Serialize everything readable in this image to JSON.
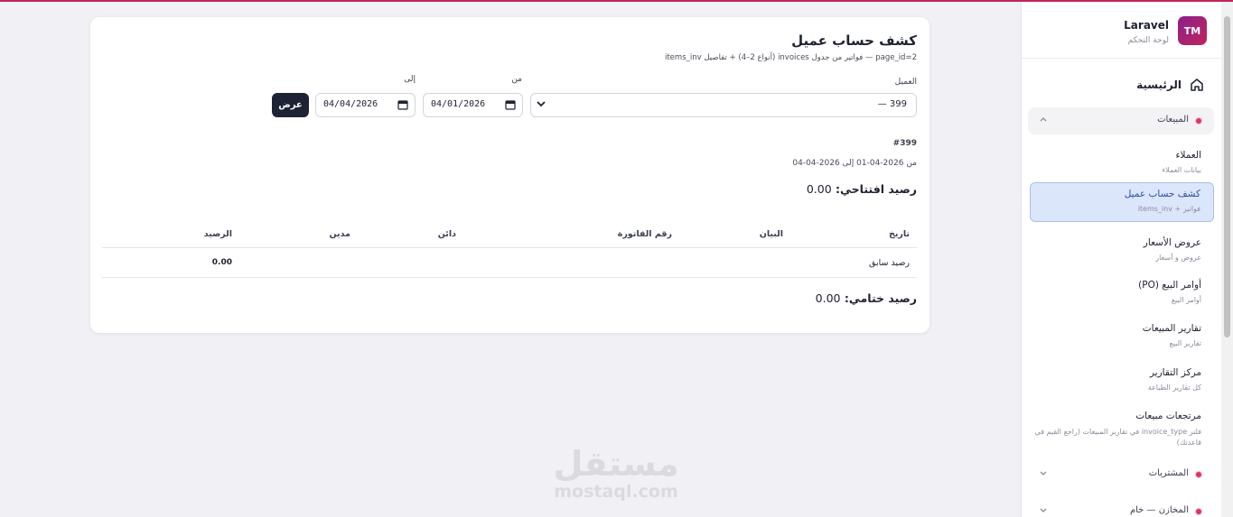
{
  "brand": {
    "logo": "TM",
    "name": "Laravel",
    "subtitle": "لوحة التحكم"
  },
  "sidebar": {
    "home_label": "الرئيسية",
    "groups": [
      {
        "label": "المبيعات",
        "icon": "chevron-up-icon"
      },
      {
        "label": "المشتريات",
        "icon": "chevron-down-icon"
      },
      {
        "label": "المخازن — خام",
        "icon": "chevron-down-icon"
      }
    ],
    "items": [
      {
        "label": "العملاء",
        "sub": "بيانات العملاء"
      },
      {
        "label": "كشف حساب عميل",
        "sub": "فواتير + items_inv",
        "active": true
      },
      {
        "label": "عروض الأسعار",
        "sub": "عروض و أسعار"
      },
      {
        "label": "أوامر البيع (PO)",
        "sub": "أوامر البيع"
      },
      {
        "label": "تقارير المبيعات",
        "sub": "تقارير البيع"
      },
      {
        "label": "مركز التقارير",
        "sub": "كل تقارير الطباعة"
      },
      {
        "label": "مرتجعات مبيعات",
        "sub": "فلتر invoice_type في تقارير المبيعات (راجع القيم في قاعدتك)"
      }
    ]
  },
  "page": {
    "title": "كشف حساب عميل",
    "subtitle": "page_id=2 — فواتير من جدول invoices (أنواع 2–4) + تفاصيل items_inv"
  },
  "filters": {
    "customer_label": "العميل",
    "customer_value": "399 —",
    "from_label": "من",
    "from_value": "04/01/2026",
    "to_label": "إلى",
    "to_value": "04/04/2026",
    "submit_label": "عرض"
  },
  "report": {
    "customer_id": "#399",
    "range": "من 2026-04-01 إلى 2026-04-04",
    "opening_label": "رصيد افتتاحي:",
    "opening_value": "0.00",
    "columns": [
      "تاريخ",
      "البيان",
      "رقم الفاتورة",
      "دائن",
      "مدين",
      "الرصيد"
    ],
    "rows": [
      {
        "date": "",
        "statement": "رصيد سابق",
        "invoice": "",
        "credit": "",
        "debit": "",
        "balance": "0.00"
      }
    ],
    "closing_label": "رصيد ختامي:",
    "closing_value": "0.00"
  },
  "watermark": {
    "ar": "مستقل",
    "en": "mostaql.com"
  },
  "colors": {
    "accent": "#c0255c",
    "primary_button": "#1e2235",
    "active_item": "#dbe6fb"
  }
}
